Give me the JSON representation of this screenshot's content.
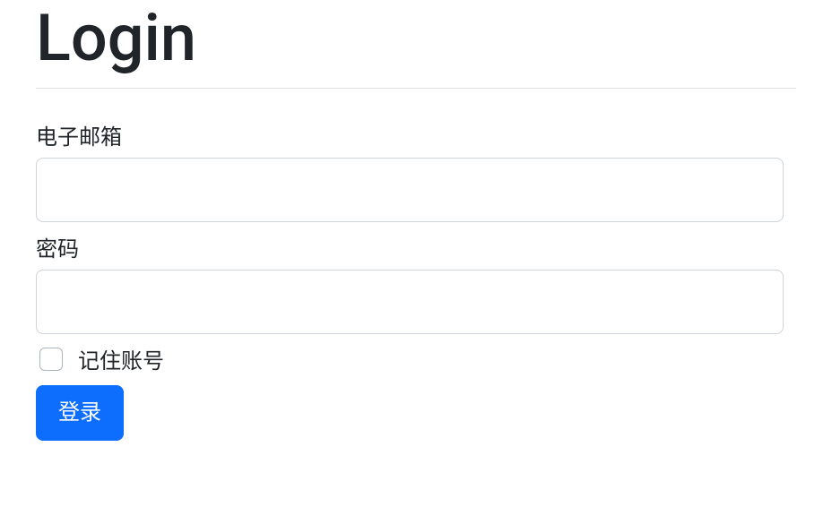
{
  "page": {
    "title": "Login"
  },
  "form": {
    "email": {
      "label": "电子邮箱",
      "value": "",
      "placeholder": ""
    },
    "password": {
      "label": "密码",
      "value": "",
      "placeholder": ""
    },
    "remember": {
      "label": "记住账号",
      "checked": false
    },
    "submit_label": "登录"
  },
  "colors": {
    "primary": "#0d6efd",
    "text": "#212529",
    "border": "#ced4da"
  }
}
